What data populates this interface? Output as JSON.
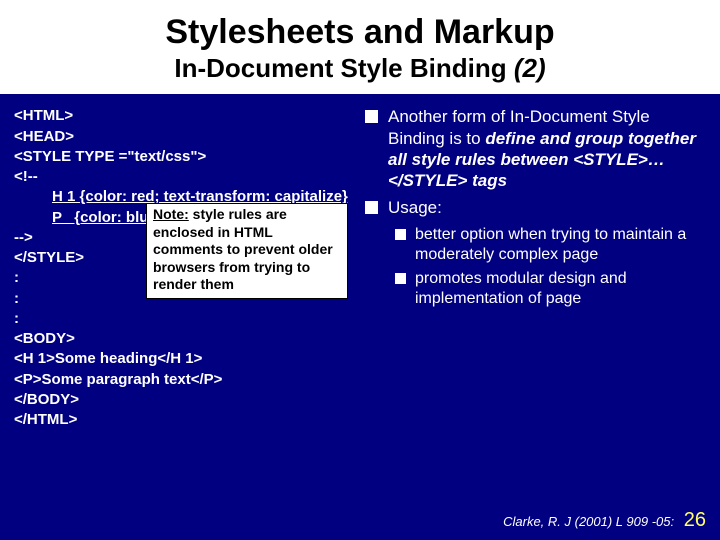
{
  "title": {
    "line1": "Stylesheets and Markup",
    "line2_a": "In-Document Style Binding ",
    "line2_b": "(2)"
  },
  "code": {
    "l1": "<HTML>",
    "l2": "<HEAD>",
    "l3": "<STYLE TYPE =\"text/css\">",
    "l4": "<!--",
    "l5": "H 1 {color: red; text-transform: capitalize}",
    "l6": "P   {color: blue}",
    "l7": "-->",
    "l8": "</STYLE>",
    "l9": ":",
    "l10": ":",
    "l11": ":",
    "l12": "<BODY>",
    "l13": "<H 1>Some heading</H 1>",
    "l14": "<P>Some paragraph text</P>",
    "l15": "</BODY>",
    "l16": "</HTML>"
  },
  "note": {
    "label": "Note:",
    "text": " style rules are enclosed in HTML comments to prevent older browsers from trying to render them"
  },
  "bullets": {
    "b1a_pre": "Another form of In-Document Style Binding is to ",
    "b1a_em": "define and group together all style rules between <STYLE>…</STYLE> tags",
    "b1b": "Usage:",
    "b2a": "better option when trying to maintain a moderately complex page",
    "b2b": "promotes modular design and implementation of page"
  },
  "footer": {
    "cite": "Clarke, R. J (2001) L 909 -05:",
    "page": "26"
  }
}
